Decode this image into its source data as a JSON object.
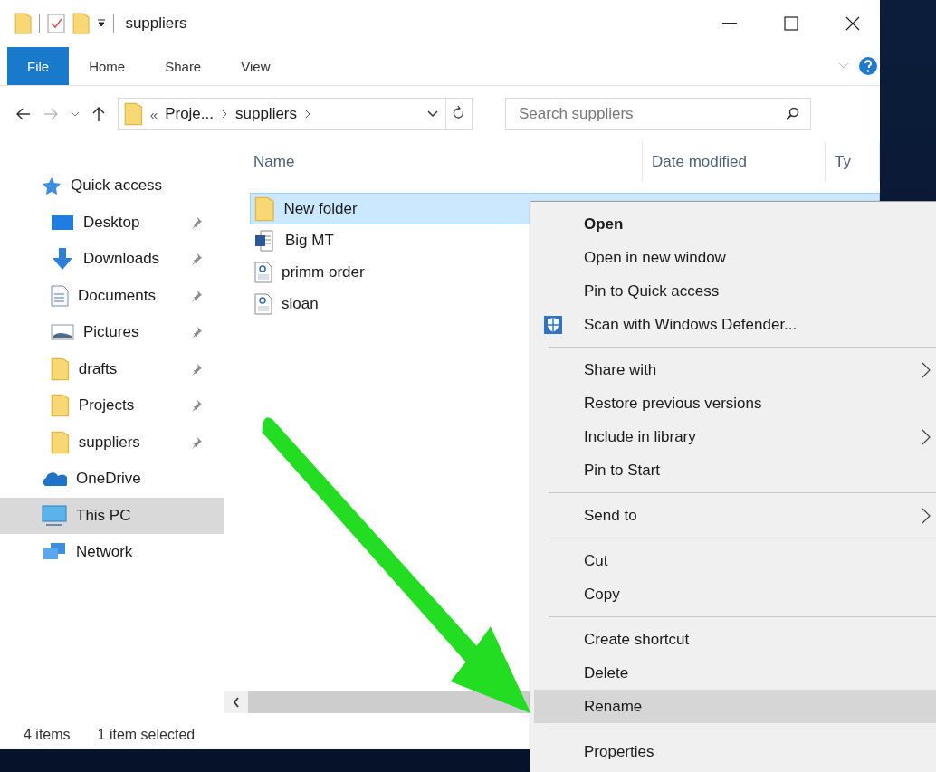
{
  "window": {
    "title": "suppliers"
  },
  "ribbon_tabs": [
    {
      "label": "File",
      "selected": true
    },
    {
      "label": "Home",
      "selected": false
    },
    {
      "label": "Share",
      "selected": false
    },
    {
      "label": "View",
      "selected": false
    }
  ],
  "address": {
    "overflow": "«",
    "crumbs": [
      "Proje...",
      "suppliers"
    ]
  },
  "search": {
    "placeholder": "Search suppliers"
  },
  "columns": [
    "Name",
    "Date modified",
    "Ty"
  ],
  "sidebar": [
    {
      "label": "Quick access",
      "kind": "star",
      "selected": false,
      "children": [
        {
          "label": "Desktop",
          "kind": "desktop",
          "pinned": true,
          "selected": false
        },
        {
          "label": "Downloads",
          "kind": "download",
          "pinned": true,
          "selected": false
        },
        {
          "label": "Documents",
          "kind": "document",
          "pinned": true,
          "selected": false
        },
        {
          "label": "Pictures",
          "kind": "pictures",
          "pinned": true,
          "selected": false
        },
        {
          "label": "drafts",
          "kind": "folder",
          "pinned": true,
          "selected": false
        },
        {
          "label": "Projects",
          "kind": "folder",
          "pinned": true,
          "selected": false
        },
        {
          "label": "suppliers",
          "kind": "folder",
          "pinned": true,
          "selected": false
        }
      ]
    },
    {
      "label": "OneDrive",
      "kind": "cloud",
      "selected": false
    },
    {
      "label": "This PC",
      "kind": "pc",
      "selected": true
    },
    {
      "label": "Network",
      "kind": "network",
      "selected": false
    }
  ],
  "files": [
    {
      "name": "New folder",
      "kind": "folder",
      "selected": true
    },
    {
      "name": "Big MT",
      "kind": "word",
      "selected": false
    },
    {
      "name": "primm order",
      "kind": "pdf",
      "selected": false
    },
    {
      "name": "sloan",
      "kind": "pdf",
      "selected": false
    }
  ],
  "status_bar": [
    "4 items",
    "1 item selected"
  ],
  "context_menu": [
    {
      "kind": "item",
      "label": "Open",
      "default": true,
      "submenu": false,
      "selected": false
    },
    {
      "kind": "item",
      "label": "Open in new window",
      "default": false,
      "submenu": false,
      "selected": false
    },
    {
      "kind": "item",
      "label": "Pin to Quick access",
      "default": false,
      "submenu": false,
      "selected": false
    },
    {
      "kind": "shield_item",
      "label": "Scan with Windows Defender...",
      "default": false,
      "submenu": false,
      "selected": false
    },
    {
      "kind": "separator"
    },
    {
      "kind": "item",
      "label": "Share with",
      "default": false,
      "submenu": true,
      "selected": false
    },
    {
      "kind": "item",
      "label": "Restore previous versions",
      "default": false,
      "submenu": false,
      "selected": false
    },
    {
      "kind": "item",
      "label": "Include in library",
      "default": false,
      "submenu": true,
      "selected": false
    },
    {
      "kind": "item",
      "label": "Pin to Start",
      "default": false,
      "submenu": false,
      "selected": false
    },
    {
      "kind": "separator"
    },
    {
      "kind": "item",
      "label": "Send to",
      "default": false,
      "submenu": true,
      "selected": false
    },
    {
      "kind": "separator"
    },
    {
      "kind": "item",
      "label": "Cut",
      "default": false,
      "submenu": false,
      "selected": false
    },
    {
      "kind": "item",
      "label": "Copy",
      "default": false,
      "submenu": false,
      "selected": false
    },
    {
      "kind": "separator"
    },
    {
      "kind": "item",
      "label": "Create shortcut",
      "default": false,
      "submenu": false,
      "selected": false
    },
    {
      "kind": "item",
      "label": "Delete",
      "default": false,
      "submenu": false,
      "selected": false
    },
    {
      "kind": "item",
      "label": "Rename",
      "default": false,
      "submenu": false,
      "selected": true
    },
    {
      "kind": "separator"
    },
    {
      "kind": "item",
      "label": "Properties",
      "default": false,
      "submenu": false,
      "selected": false
    }
  ]
}
